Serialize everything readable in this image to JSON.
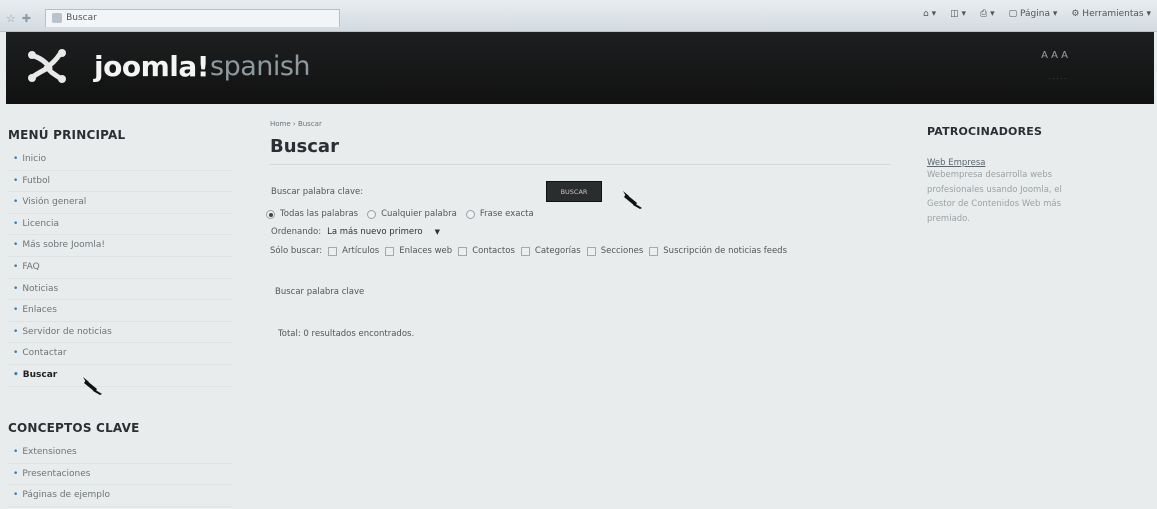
{
  "browser": {
    "tab_title": "Buscar",
    "tools": [
      "Página",
      "Herramientas"
    ]
  },
  "header": {
    "logo_main": "joomla!",
    "logo_sub": "spanish",
    "header_icons": "A A A"
  },
  "left_menu": {
    "title": "MENÚ PRINCIPAL",
    "items": [
      "Inicio",
      "Futbol",
      "Visión general",
      "Licencia",
      "Más sobre Joomla!",
      "FAQ",
      "Noticias",
      "Enlaces",
      "Servidor de noticias",
      "Contactar",
      "Buscar"
    ],
    "active": "Buscar"
  },
  "key_concepts": {
    "title": "CONCEPTOS CLAVE",
    "items": [
      "Extensiones",
      "Presentaciones",
      "Páginas de ejemplo"
    ]
  },
  "main": {
    "breadcrumb": [
      "Home",
      "Buscar"
    ],
    "title": "Buscar",
    "search_label": "Buscar palabra clave:",
    "search_button": "BUSCAR",
    "radio_options": [
      "Todas las palabras",
      "Cualquier palabra",
      "Frase exacta"
    ],
    "radio_selected": "Todas las palabras",
    "ordering_label": "Ordenando:",
    "ordering_value": "La más nuevo primero",
    "only_search_label": "Sólo buscar:",
    "only_search_options": [
      "Artículos",
      "Enlaces web",
      "Contactos",
      "Categorías",
      "Secciones",
      "Suscripción de noticias feeds"
    ],
    "results_label": "Buscar palabra clave",
    "total": "Total: 0 resultados encontrados."
  },
  "right": {
    "title": "PATROCINADORES",
    "link": "Web Empresa",
    "text": "Webempresa desarrolla webs profesionales usando Joomla, el Gestor de Contenidos Web más premiado."
  }
}
